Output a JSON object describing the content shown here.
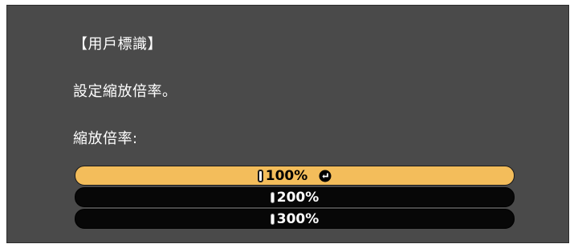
{
  "dialog": {
    "title": "【用戶標識】",
    "message": "設定縮放倍率。",
    "field_label": "縮放倍率:"
  },
  "options": [
    {
      "label": "100%",
      "selected": true,
      "icon": "enter-icon"
    },
    {
      "label": "200%",
      "selected": false
    },
    {
      "label": "300%",
      "selected": false
    }
  ],
  "colors": {
    "background": "#4a4a4a",
    "selected_bar": "#f3bd5b",
    "unselected_bar": "#070707",
    "text": "#ffffff"
  }
}
